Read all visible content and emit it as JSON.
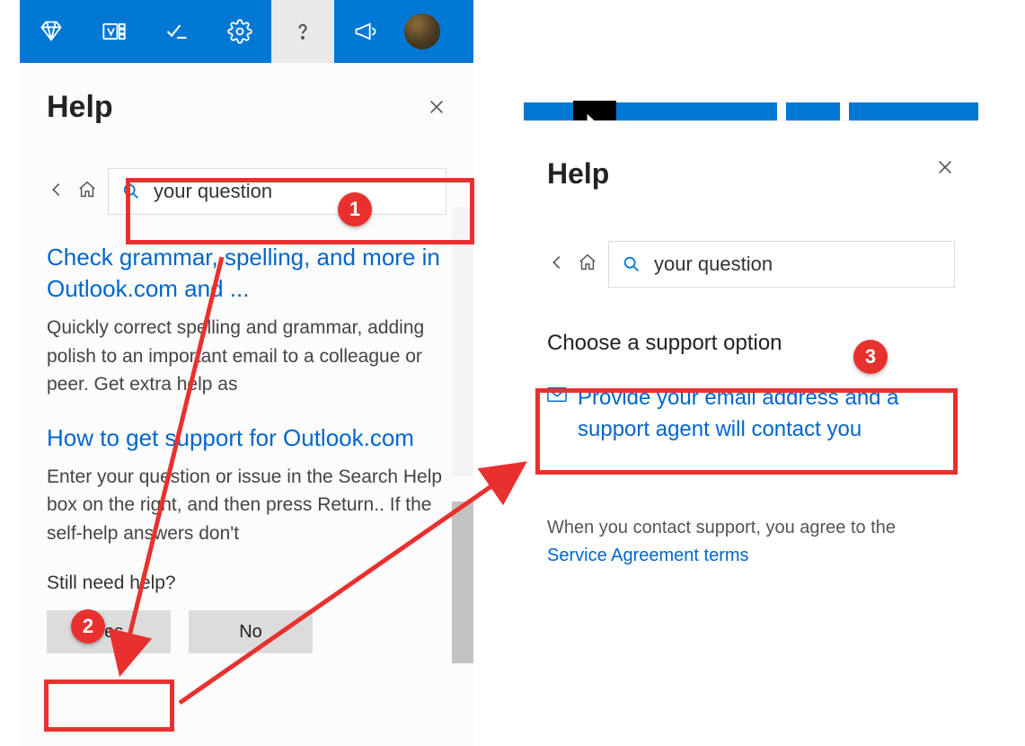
{
  "left": {
    "title": "Help",
    "search_value": "your question",
    "results": [
      {
        "title": "Check grammar, spelling, and more in Outlook.com and ...",
        "desc": "Quickly correct spelling and grammar, adding polish to an important email to a colleague or peer. Get extra help as"
      },
      {
        "title": "How to get support for Outlook.com",
        "desc": "Enter your question or issue in the Search Help box on the right, and then press Return.. If the self-help answers don't"
      }
    ],
    "still": "Still need help?",
    "yes": "Yes",
    "no": "No"
  },
  "right": {
    "title": "Help",
    "search_value": "your question",
    "subhead": "Choose a support option",
    "support_link": "Provide your email address and a support agent will contact you",
    "agree_prefix": "When you contact support, you agree to the ",
    "agree_link": "Service Agreement terms"
  },
  "annotations": {
    "n1": "1",
    "n2": "2",
    "n3": "3"
  }
}
